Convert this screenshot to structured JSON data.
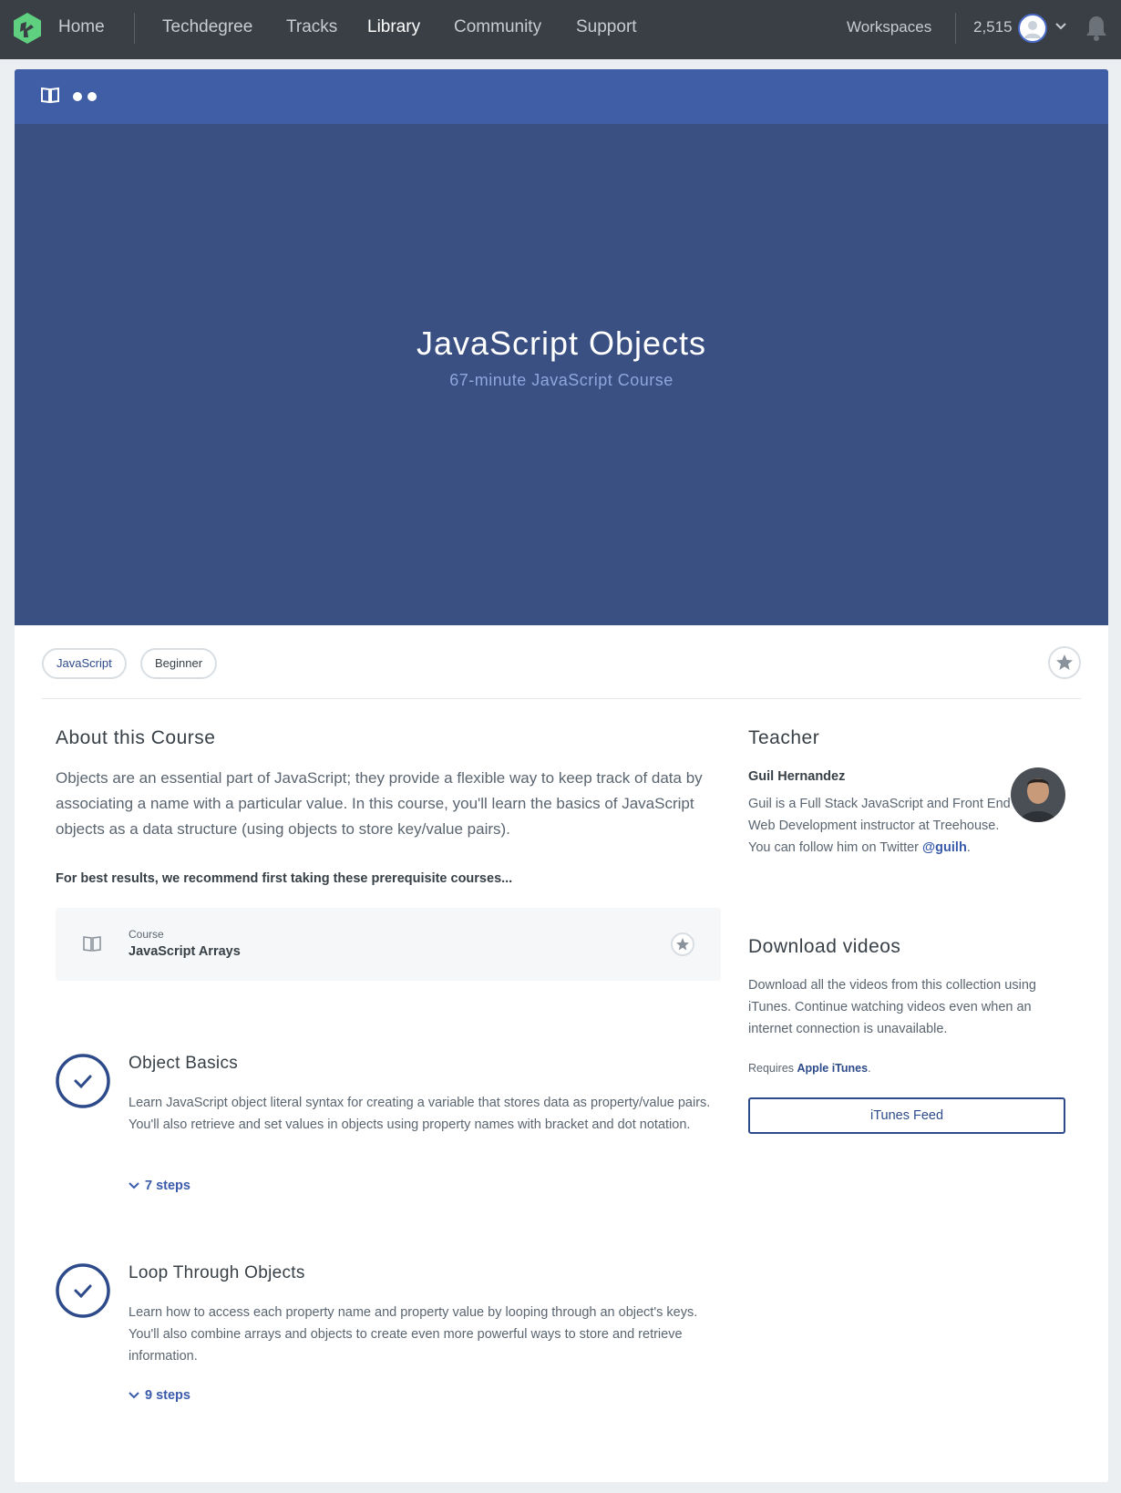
{
  "nav": {
    "home": "Home",
    "links": [
      "Techdegree",
      "Tracks",
      "Library",
      "Community",
      "Support"
    ],
    "workspaces": "Workspaces",
    "points": "2,515"
  },
  "hero": {
    "title": "JavaScript Objects",
    "subtitle": "67-minute JavaScript Course"
  },
  "tags": [
    "JavaScript",
    "Beginner"
  ],
  "about": {
    "heading": "About this Course",
    "text": "Objects are an essential part of JavaScript; they provide a flexible way to keep track of data by associating a name with a particular value. In this course, you'll learn the basics of JavaScript objects as a data structure (using objects to store key/value pairs).",
    "prereq_label": "For best results, we recommend first taking these prerequisite courses...",
    "prereq_type": "Course",
    "prereq_name": "JavaScript Arrays"
  },
  "stages": [
    {
      "title": "Object Basics",
      "description": "Learn JavaScript object literal syntax for creating a variable that stores data as property/value pairs. You'll also retrieve and set values in objects using property names with bracket and dot notation.",
      "steps": "7 steps"
    },
    {
      "title": "Loop Through Objects",
      "description": "Learn how to access each property name and property value by looping through an object's keys. You'll also combine arrays and objects to create even more powerful ways to store and retrieve information.",
      "steps": "9 steps"
    }
  ],
  "teacher": {
    "heading": "Teacher",
    "name": "Guil Hernandez",
    "bio": "Guil is a Full Stack JavaScript and Front End Web Development instructor at Treehouse. You can follow him on Twitter",
    "twitter": "@guilh",
    "bio_end": "."
  },
  "download": {
    "heading": "Download videos",
    "text": "Download all the videos from this collection using iTunes. Continue watching videos even when an internet connection is unavailable.",
    "requires": "Requires",
    "requires_link": "Apple iTunes",
    "requires_end": ".",
    "button": "iTunes Feed"
  },
  "colors": {
    "nav_bg": "#3a3f46",
    "hero_bar": "#3f5ea5",
    "hero_bg": "#3a5083",
    "accent": "#2d4a8a",
    "logo_green": "#5fcf80"
  }
}
